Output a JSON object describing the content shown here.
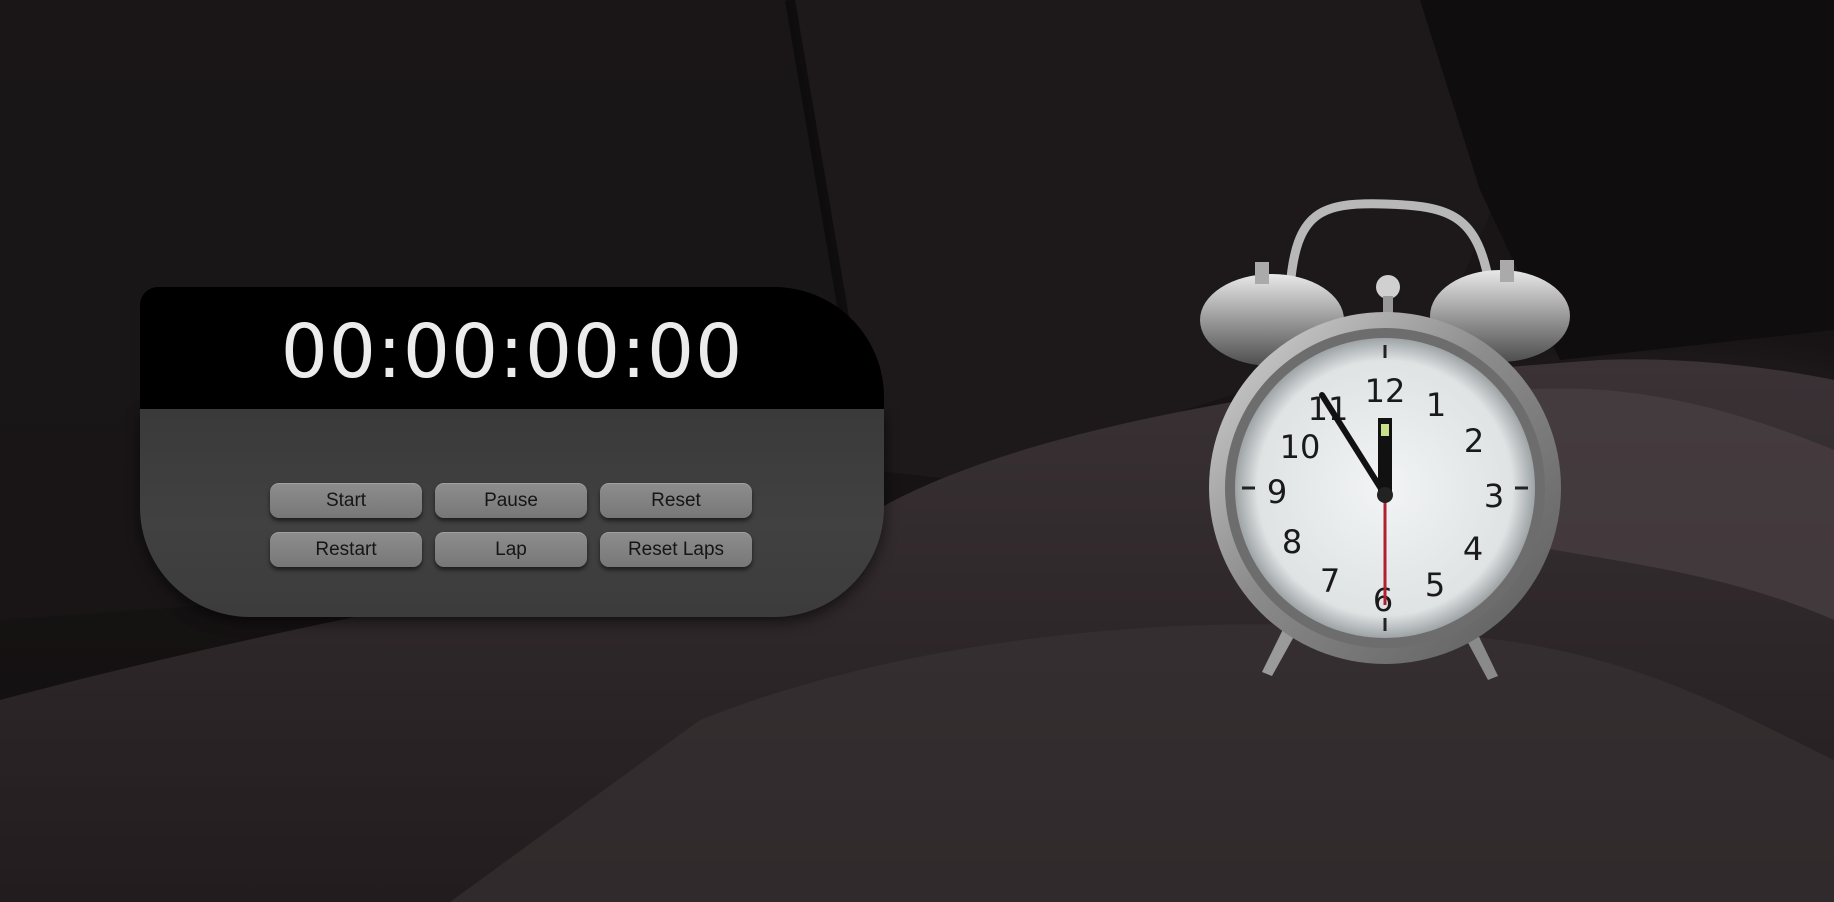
{
  "stopwatch": {
    "time_display": "00:00:00:00",
    "buttons": {
      "start": "Start",
      "pause": "Pause",
      "reset": "Reset",
      "restart": "Restart",
      "lap": "Lap",
      "reset_laps": "Reset Laps"
    }
  },
  "background": {
    "clock_face_numbers": [
      "12",
      "1",
      "2",
      "3",
      "4",
      "5",
      "6",
      "7",
      "8",
      "9",
      "10",
      "11"
    ]
  }
}
